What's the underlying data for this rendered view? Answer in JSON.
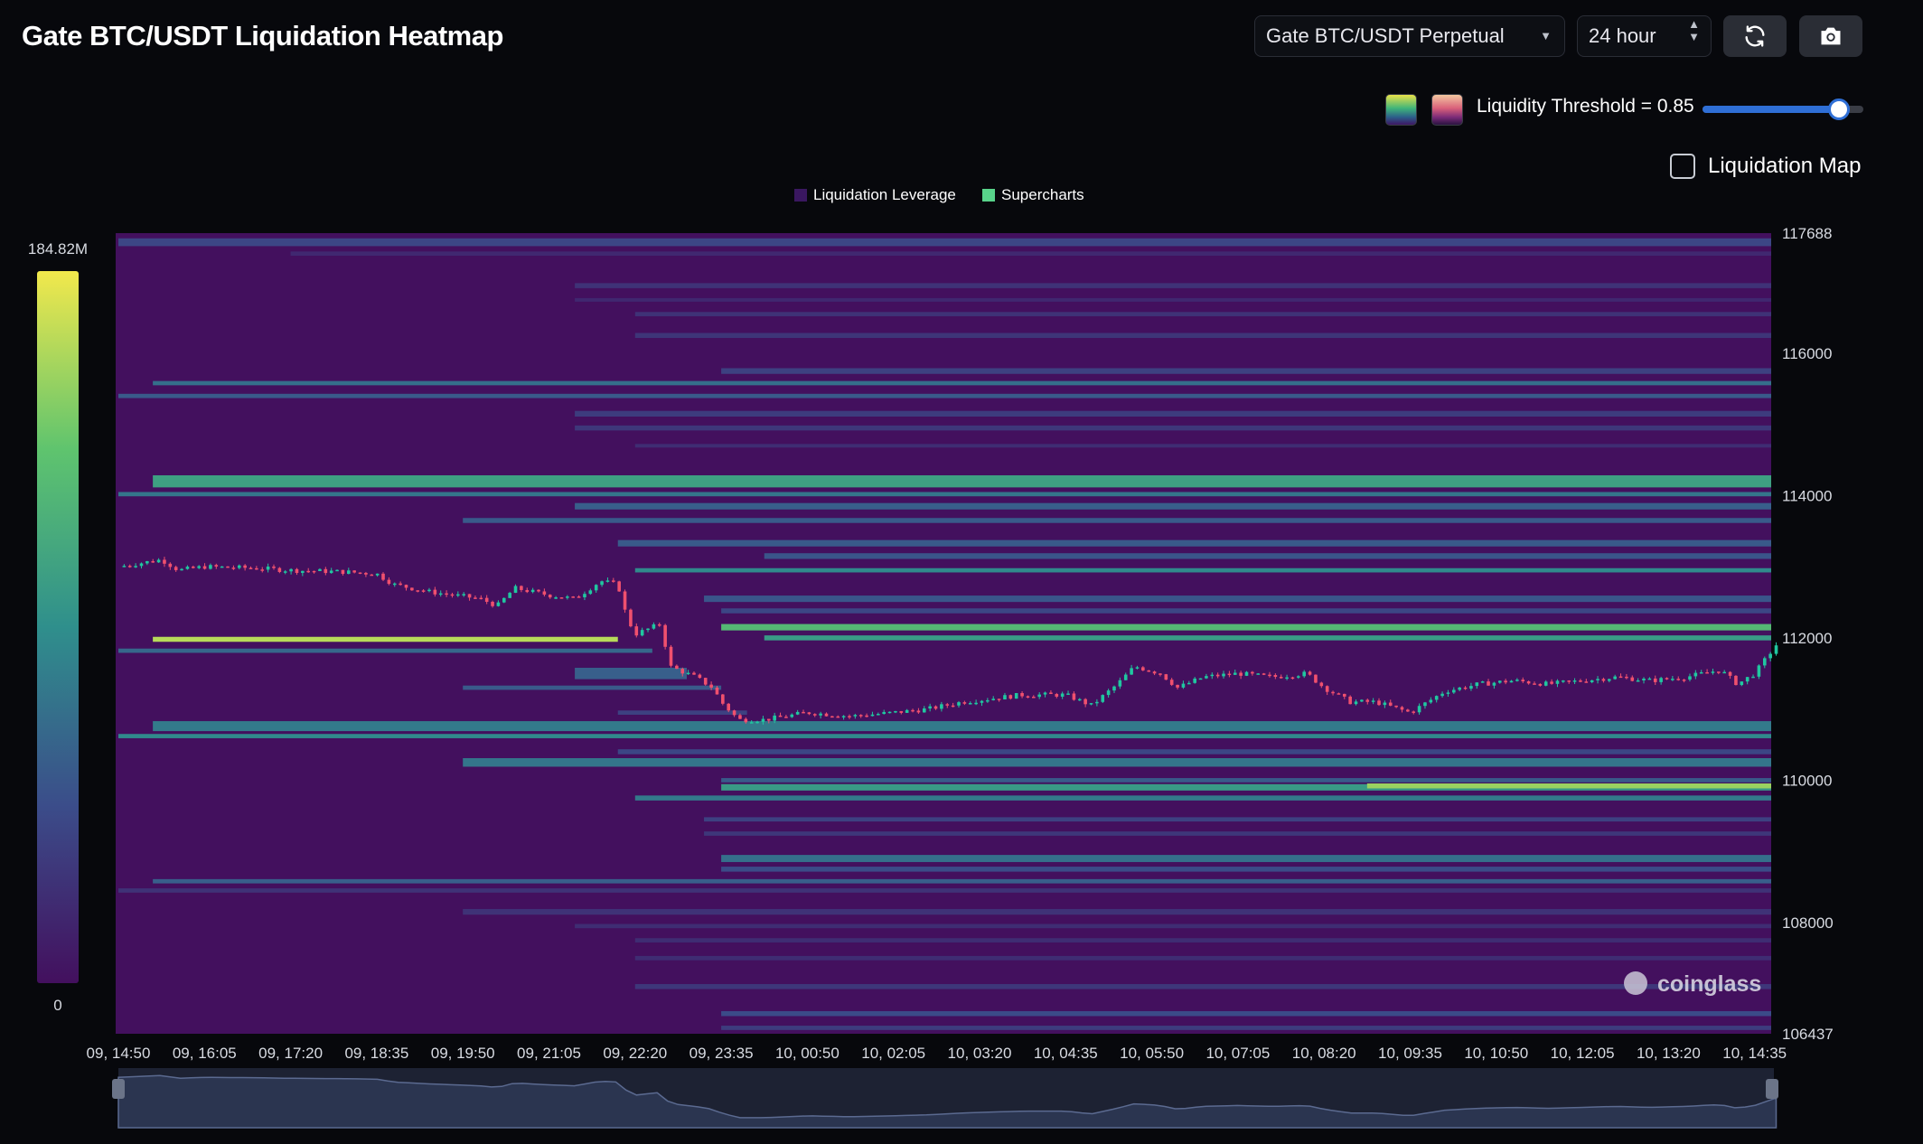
{
  "header": {
    "title": "Gate BTC/USDT Liquidation Heatmap",
    "exchange_select": "Gate BTC/USDT Perpetual",
    "timeframe_select": "24 hour",
    "refresh_icon": "refresh-icon",
    "camera_icon": "camera-icon"
  },
  "controls": {
    "threshold_label": "Liquidity Threshold = 0.85",
    "threshold_value": 0.85,
    "liquidation_map_label": "Liquidation Map",
    "liquidation_map_checked": false
  },
  "watermark": "coinglass",
  "colors": {
    "background": "#07080c",
    "heat_base": "#43105e",
    "heat_high": "#f5ea4a",
    "candle_up": "#20c7a0",
    "candle_down": "#f0506e",
    "accent": "#2f6fd6"
  },
  "chart_data": {
    "type": "heatmap",
    "legend": [
      {
        "name": "Liquidation Leverage",
        "color": "#3a1760"
      },
      {
        "name": "Supercharts",
        "color": "#58d38a"
      }
    ],
    "colorbar": {
      "max_label": "184.82M",
      "min_label": "0"
    },
    "x_ticks": [
      "09, 14:50",
      "09, 16:05",
      "09, 17:20",
      "09, 18:35",
      "09, 19:50",
      "09, 21:05",
      "09, 22:20",
      "09, 23:35",
      "10, 00:50",
      "10, 02:05",
      "10, 03:20",
      "10, 04:35",
      "10, 05:50",
      "10, 07:05",
      "10, 08:20",
      "10, 09:35",
      "10, 10:50",
      "10, 12:05",
      "10, 13:20",
      "10, 14:35"
    ],
    "y_ticks": [
      "117688",
      "116000",
      "114000",
      "112000",
      "110000",
      "108000",
      "106437"
    ],
    "ylim": [
      106437,
      117688
    ],
    "bands": [
      {
        "price": 117560,
        "start": 0,
        "end": 19.25,
        "intensity": 0.22,
        "thickness": 110
      },
      {
        "price": 117400,
        "start": 2.0,
        "end": 19.25,
        "intensity": 0.1,
        "thickness": 60
      },
      {
        "price": 116950,
        "start": 5.3,
        "end": 19.25,
        "intensity": 0.14,
        "thickness": 70
      },
      {
        "price": 116750,
        "start": 5.3,
        "end": 19.25,
        "intensity": 0.1,
        "thickness": 50
      },
      {
        "price": 116550,
        "start": 6.0,
        "end": 19.25,
        "intensity": 0.14,
        "thickness": 60
      },
      {
        "price": 116250,
        "start": 6.0,
        "end": 19.25,
        "intensity": 0.15,
        "thickness": 70
      },
      {
        "price": 115750,
        "start": 7.0,
        "end": 19.25,
        "intensity": 0.2,
        "thickness": 80
      },
      {
        "price": 115580,
        "start": 0.4,
        "end": 19.25,
        "intensity": 0.38,
        "thickness": 60
      },
      {
        "price": 115400,
        "start": 0,
        "end": 19.25,
        "intensity": 0.3,
        "thickness": 60
      },
      {
        "price": 115150,
        "start": 5.3,
        "end": 19.25,
        "intensity": 0.18,
        "thickness": 80
      },
      {
        "price": 114950,
        "start": 5.3,
        "end": 19.25,
        "intensity": 0.16,
        "thickness": 70
      },
      {
        "price": 114700,
        "start": 6.0,
        "end": 19.25,
        "intensity": 0.12,
        "thickness": 50
      },
      {
        "price": 114200,
        "start": 0.4,
        "end": 19.25,
        "intensity": 0.58,
        "thickness": 170
      },
      {
        "price": 114020,
        "start": 0,
        "end": 19.25,
        "intensity": 0.4,
        "thickness": 60
      },
      {
        "price": 113850,
        "start": 5.3,
        "end": 19.25,
        "intensity": 0.32,
        "thickness": 90
      },
      {
        "price": 113650,
        "start": 4.0,
        "end": 19.25,
        "intensity": 0.3,
        "thickness": 70
      },
      {
        "price": 113330,
        "start": 5.8,
        "end": 19.25,
        "intensity": 0.3,
        "thickness": 90
      },
      {
        "price": 113150,
        "start": 7.5,
        "end": 19.25,
        "intensity": 0.28,
        "thickness": 80
      },
      {
        "price": 112950,
        "start": 6.0,
        "end": 19.25,
        "intensity": 0.48,
        "thickness": 60
      },
      {
        "price": 112550,
        "start": 6.8,
        "end": 19.25,
        "intensity": 0.28,
        "thickness": 90
      },
      {
        "price": 112380,
        "start": 7.0,
        "end": 19.25,
        "intensity": 0.22,
        "thickness": 70
      },
      {
        "price": 112150,
        "start": 7.0,
        "end": 19.25,
        "intensity": 0.7,
        "thickness": 90
      },
      {
        "price": 112000,
        "start": 7.5,
        "end": 19.25,
        "intensity": 0.55,
        "thickness": 70
      },
      {
        "price": 111980,
        "start": 0.4,
        "end": 5.8,
        "intensity": 0.9,
        "thickness": 70
      },
      {
        "price": 111820,
        "start": 0,
        "end": 6.2,
        "intensity": 0.35,
        "thickness": 60
      },
      {
        "price": 111500,
        "start": 5.3,
        "end": 6.6,
        "intensity": 0.32,
        "thickness": 160
      },
      {
        "price": 111300,
        "start": 4.0,
        "end": 7.0,
        "intensity": 0.3,
        "thickness": 60
      },
      {
        "price": 110950,
        "start": 5.8,
        "end": 7.3,
        "intensity": 0.2,
        "thickness": 60
      },
      {
        "price": 110760,
        "start": 0.4,
        "end": 19.25,
        "intensity": 0.42,
        "thickness": 140
      },
      {
        "price": 110620,
        "start": 0,
        "end": 19.25,
        "intensity": 0.48,
        "thickness": 60
      },
      {
        "price": 110400,
        "start": 5.8,
        "end": 19.25,
        "intensity": 0.22,
        "thickness": 70
      },
      {
        "price": 110250,
        "start": 4.0,
        "end": 19.25,
        "intensity": 0.4,
        "thickness": 120
      },
      {
        "price": 110000,
        "start": 7.0,
        "end": 19.25,
        "intensity": 0.3,
        "thickness": 60
      },
      {
        "price": 109900,
        "start": 7.0,
        "end": 19.25,
        "intensity": 0.55,
        "thickness": 90
      },
      {
        "price": 109920,
        "start": 14.5,
        "end": 19.25,
        "intensity": 0.85,
        "thickness": 70
      },
      {
        "price": 109750,
        "start": 6.0,
        "end": 19.25,
        "intensity": 0.42,
        "thickness": 70
      },
      {
        "price": 109450,
        "start": 6.8,
        "end": 19.25,
        "intensity": 0.2,
        "thickness": 60
      },
      {
        "price": 109250,
        "start": 6.8,
        "end": 19.25,
        "intensity": 0.16,
        "thickness": 60
      },
      {
        "price": 108900,
        "start": 7.0,
        "end": 19.25,
        "intensity": 0.38,
        "thickness": 100
      },
      {
        "price": 108750,
        "start": 7.0,
        "end": 19.25,
        "intensity": 0.24,
        "thickness": 70
      },
      {
        "price": 108580,
        "start": 0.4,
        "end": 19.25,
        "intensity": 0.32,
        "thickness": 60
      },
      {
        "price": 108450,
        "start": 0,
        "end": 19.25,
        "intensity": 0.14,
        "thickness": 60
      },
      {
        "price": 108150,
        "start": 4.0,
        "end": 19.25,
        "intensity": 0.14,
        "thickness": 80
      },
      {
        "price": 107950,
        "start": 5.3,
        "end": 19.25,
        "intensity": 0.12,
        "thickness": 60
      },
      {
        "price": 107750,
        "start": 6.0,
        "end": 19.25,
        "intensity": 0.12,
        "thickness": 60
      },
      {
        "price": 107500,
        "start": 6.0,
        "end": 19.25,
        "intensity": 0.12,
        "thickness": 60
      },
      {
        "price": 107100,
        "start": 6.0,
        "end": 19.25,
        "intensity": 0.16,
        "thickness": 70
      },
      {
        "price": 106720,
        "start": 7.0,
        "end": 19.25,
        "intensity": 0.24,
        "thickness": 70
      },
      {
        "price": 106520,
        "start": 7.0,
        "end": 19.25,
        "intensity": 0.18,
        "thickness": 60
      }
    ],
    "price_series": [
      {
        "t": 0.0,
        "p": 113000
      },
      {
        "t": 0.5,
        "p": 113100
      },
      {
        "t": 0.7,
        "p": 112950
      },
      {
        "t": 1.0,
        "p": 113000
      },
      {
        "t": 1.6,
        "p": 112980
      },
      {
        "t": 2.0,
        "p": 112950
      },
      {
        "t": 2.6,
        "p": 112930
      },
      {
        "t": 3.0,
        "p": 112900
      },
      {
        "t": 3.2,
        "p": 112750
      },
      {
        "t": 3.6,
        "p": 112650
      },
      {
        "t": 4.2,
        "p": 112550
      },
      {
        "t": 4.4,
        "p": 112450
      },
      {
        "t": 4.6,
        "p": 112700
      },
      {
        "t": 5.0,
        "p": 112600
      },
      {
        "t": 5.3,
        "p": 112550
      },
      {
        "t": 5.6,
        "p": 112800
      },
      {
        "t": 5.8,
        "p": 112750
      },
      {
        "t": 5.9,
        "p": 112300
      },
      {
        "t": 6.0,
        "p": 112050
      },
      {
        "t": 6.3,
        "p": 112200
      },
      {
        "t": 6.4,
        "p": 111600
      },
      {
        "t": 6.7,
        "p": 111450
      },
      {
        "t": 6.9,
        "p": 111300
      },
      {
        "t": 7.0,
        "p": 111100
      },
      {
        "t": 7.2,
        "p": 110850
      },
      {
        "t": 7.5,
        "p": 110850
      },
      {
        "t": 8.0,
        "p": 110950
      },
      {
        "t": 8.5,
        "p": 110900
      },
      {
        "t": 9.0,
        "p": 110950
      },
      {
        "t": 9.4,
        "p": 111000
      },
      {
        "t": 9.8,
        "p": 111100
      },
      {
        "t": 10.5,
        "p": 111200
      },
      {
        "t": 11.0,
        "p": 111200
      },
      {
        "t": 11.3,
        "p": 111050
      },
      {
        "t": 11.6,
        "p": 111350
      },
      {
        "t": 11.8,
        "p": 111600
      },
      {
        "t": 12.1,
        "p": 111500
      },
      {
        "t": 12.3,
        "p": 111300
      },
      {
        "t": 12.6,
        "p": 111450
      },
      {
        "t": 13.0,
        "p": 111500
      },
      {
        "t": 13.4,
        "p": 111450
      },
      {
        "t": 13.8,
        "p": 111500
      },
      {
        "t": 14.0,
        "p": 111300
      },
      {
        "t": 14.3,
        "p": 111100
      },
      {
        "t": 14.6,
        "p": 111100
      },
      {
        "t": 15.0,
        "p": 110950
      },
      {
        "t": 15.4,
        "p": 111250
      },
      {
        "t": 15.8,
        "p": 111350
      },
      {
        "t": 16.2,
        "p": 111400
      },
      {
        "t": 16.6,
        "p": 111350
      },
      {
        "t": 17.0,
        "p": 111400
      },
      {
        "t": 17.4,
        "p": 111450
      },
      {
        "t": 17.8,
        "p": 111400
      },
      {
        "t": 18.2,
        "p": 111450
      },
      {
        "t": 18.6,
        "p": 111550
      },
      {
        "t": 18.8,
        "p": 111350
      },
      {
        "t": 19.0,
        "p": 111500
      },
      {
        "t": 19.25,
        "p": 111900
      }
    ]
  }
}
